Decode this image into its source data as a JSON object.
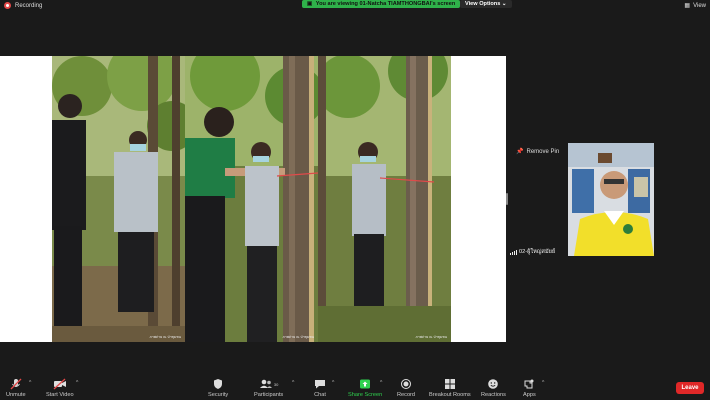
{
  "topbar": {
    "recording_label": "Recording",
    "banner_text": "You are viewing 01-Natcha TIAMTHONGBAI's screen",
    "view_options_label": "View Options",
    "view_label": "View"
  },
  "share": {
    "caption_1": "ภาพถ่าย ณ ป่าชุมชน",
    "caption_2": "ภาพถ่าย ณ ป่าชุมชน",
    "caption_3": "ภาพถ่าย ณ ป่าชุมชน"
  },
  "participant": {
    "remove_pin_label": "Remove Pin",
    "name": "02-ผู้ใหญ่สมัยย์"
  },
  "toolbar": {
    "unmute_label": "Unmute",
    "start_video_label": "Start Video",
    "security_label": "Security",
    "participants_label": "Participants",
    "participants_count": "30",
    "chat_label": "Chat",
    "share_screen_label": "Share Screen",
    "record_label": "Record",
    "breakout_label": "Breakout Rooms",
    "reactions_label": "Reactions",
    "apps_label": "Apps",
    "leave_label": "Leave"
  },
  "colors": {
    "accent_green": "#2fb14a",
    "leave_red": "#e02828",
    "background": "#1a1a1a"
  }
}
